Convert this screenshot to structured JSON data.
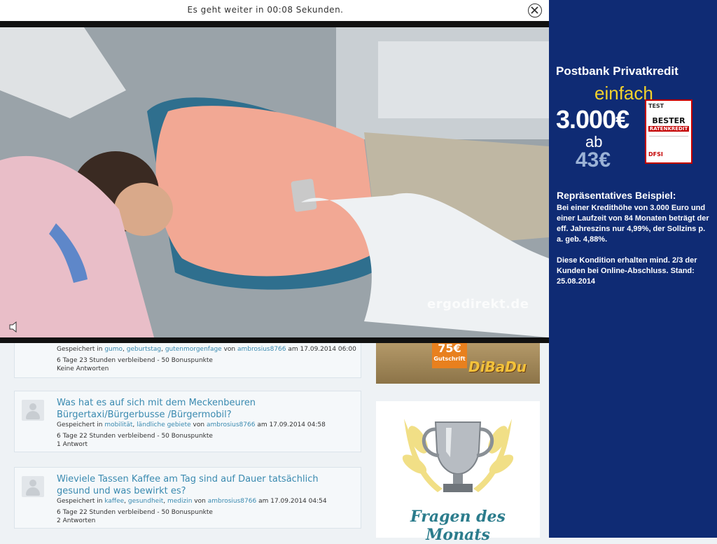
{
  "overlay": {
    "countdown_text": "Es geht weiter in 00:08  Sekunden.",
    "close_icon": "close-icon",
    "video_watermark": "ergodirekt.de",
    "volume_icon": "speaker-icon"
  },
  "questions": [
    {
      "title": "",
      "saved_in_label": "Gespeichert in",
      "tags": [
        "gumo",
        "geburtstag",
        "gutenmorgenfage"
      ],
      "by_label": "von",
      "user": "ambrosius8766",
      "date_label": "am 17.09.2014 06:00",
      "remaining": "6 Tage 23 Stunden verbleibend - 50 Bonuspunkte",
      "answers": "Keine Antworten"
    },
    {
      "title": "Was hat es auf sich mit dem Meckenbeuren Bürgertaxi/Bürgerbusse /Bürgermobil?",
      "saved_in_label": "Gespeichert in",
      "tags": [
        "mobilität",
        "ländliche gebiete"
      ],
      "by_label": "von",
      "user": "ambrosius8766",
      "date_label": "am 17.09.2014 04:58",
      "remaining": "6 Tage 22 Stunden verbleibend - 50 Bonuspunkte",
      "answers": "1 Antwort"
    },
    {
      "title": "Wieviele Tassen Kaffee am Tag sind auf Dauer tatsächlich gesund und was bewirkt es?",
      "saved_in_label": "Gespeichert in",
      "tags": [
        "kaffee",
        "gesundheit",
        "medizin"
      ],
      "by_label": "von",
      "user": "ambrosius8766",
      "date_label": "am 17.09.2014 04:54",
      "remaining": "6 Tage 22 Stunden verbleibend - 50 Bonuspunkte",
      "answers": "2 Antworten"
    }
  ],
  "side_banner": {
    "badge_big": "75€",
    "badge_small": "Gutschrift",
    "logo_text": "DiBaDu"
  },
  "trophy": {
    "label": "Fragen des Monats",
    "icon": "trophy-icon"
  },
  "right_ad": {
    "title": "Postbank  Privatkredit",
    "einfach": "einfach",
    "amount": "3.000€",
    "ab": "ab",
    "rate": "43€",
    "test_top": "TEST",
    "test_best": "BESTER",
    "test_red": "RATENKREDIT",
    "test_dfsi": "DFSI",
    "rep_title": "Repräsentatives Beispiel:",
    "body1": "Bei einer Kredithöhe von 3.000 Euro und einer Laufzeit von 84 Monaten beträgt der eff. Jahreszins nur 4,99%, der Sollzins p. a. geb. 4,88%.",
    "body2": "Diese Kondition erhalten mind. 2/3 der Kunden bei Online-Abschluss. Stand: 25.08.2014"
  },
  "colors": {
    "link": "#3a8ab0",
    "ad_blue": "#0f2b74",
    "ad_yellow": "#f3d22b"
  }
}
